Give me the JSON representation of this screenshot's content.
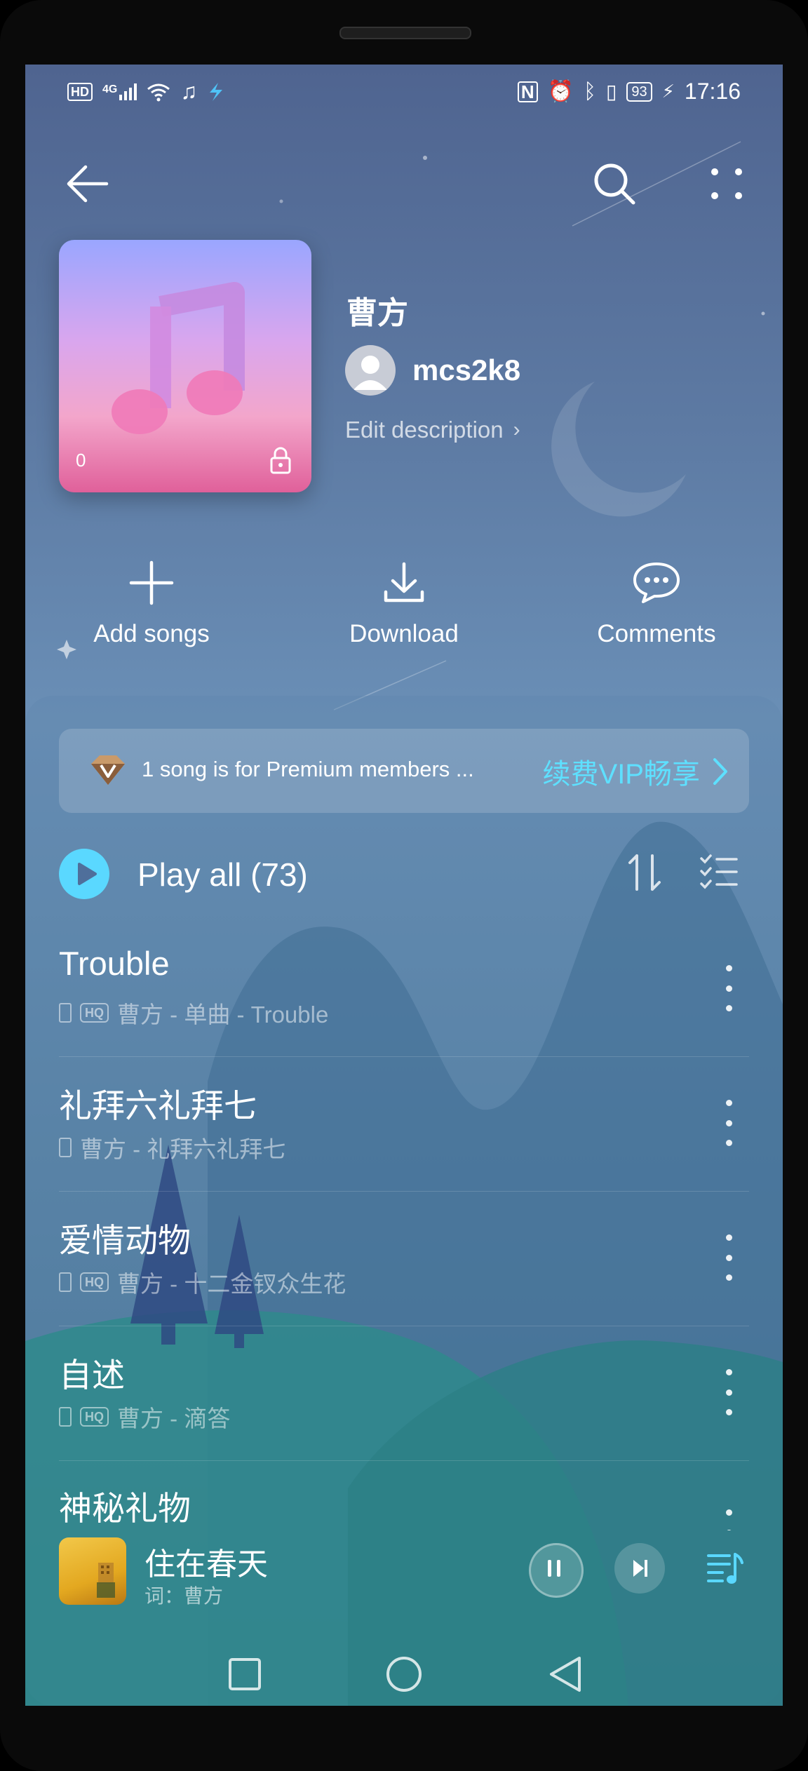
{
  "status_bar": {
    "left_icons": [
      "hd-icon",
      "4g-signal-icon",
      "wifi-icon",
      "music-note-icon",
      "app-icon"
    ],
    "hd_label": "HD",
    "net_label": "4G",
    "battery": "93",
    "time": "17:16"
  },
  "header": {
    "playlist_title": "曹方",
    "username": "mcs2k8",
    "edit_description": "Edit description",
    "cover_count": "0"
  },
  "actions": [
    {
      "label": "Add songs",
      "icon": "plus-icon"
    },
    {
      "label": "Download",
      "icon": "download-icon"
    },
    {
      "label": "Comments",
      "icon": "comments-icon"
    }
  ],
  "vip_banner": {
    "text": "1 song is for Premium members ...",
    "cta": "续费VIP畅享"
  },
  "play_all": {
    "label": "Play all (73)"
  },
  "songs": [
    {
      "title": "Trouble",
      "meta": "曹方 - 单曲 - Trouble",
      "hq": true
    },
    {
      "title": "礼拜六礼拜七",
      "meta": "曹方 - 礼拜六礼拜七",
      "hq": false
    },
    {
      "title": "爱情动物",
      "meta": "曹方 - 十二金钗众生花",
      "hq": true
    },
    {
      "title": "自述",
      "meta": "曹方 - 滴答",
      "hq": true
    },
    {
      "title": "神秘礼物",
      "meta": "",
      "hq": false
    }
  ],
  "hq_label": "HQ",
  "mini_player": {
    "title": "住在春天",
    "subtitle": "词：曹方"
  },
  "colors": {
    "accent": "#5ad8ff",
    "vip_text": "#5ee0ff",
    "background_top": "#4f6490",
    "background_bottom": "#40708e"
  }
}
